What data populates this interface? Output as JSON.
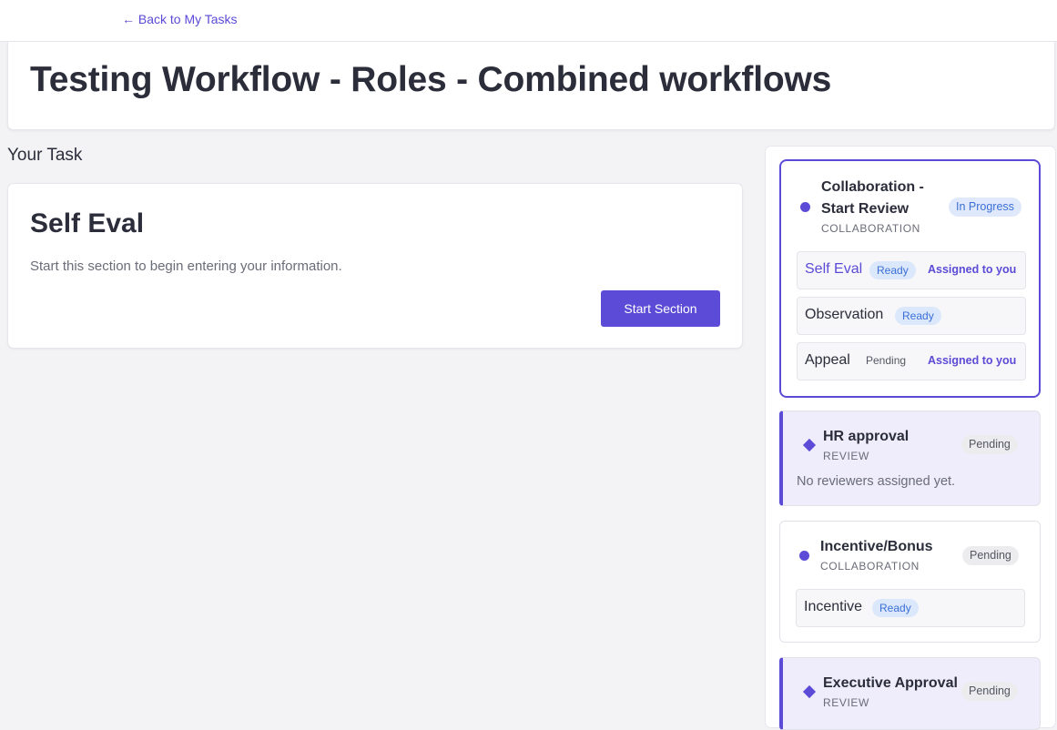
{
  "nav": {
    "back_label": "← Back to My Tasks"
  },
  "page": {
    "title": "Testing Workflow - Roles - Combined workflows"
  },
  "task": {
    "heading": "Your Task",
    "card_title": "Self Eval",
    "description": "Start this section to begin entering your information.",
    "button_label": "Start Section"
  },
  "workflow": {
    "stages": [
      {
        "name_line1": "Collaboration -",
        "name_line2": "Start Review",
        "type": "COLLABORATION",
        "status": "In Progress",
        "sections": [
          {
            "label": "Self Eval",
            "status": "Ready",
            "assigned": "Assigned to you"
          },
          {
            "label": "Observation",
            "status": "Ready",
            "assigned": ""
          },
          {
            "label": "Appeal",
            "status": "Pending",
            "assigned": "Assigned to you"
          }
        ]
      },
      {
        "name": "HR approval",
        "type": "REVIEW",
        "status": "Pending",
        "note": "No reviewers assigned yet."
      },
      {
        "name": "Incentive/Bonus",
        "type": "COLLABORATION",
        "status": "Pending",
        "sections": [
          {
            "label": "Incentive",
            "status": "Ready"
          }
        ]
      },
      {
        "name": "Executive Approval",
        "type": "REVIEW",
        "status": "Pending"
      }
    ]
  },
  "colors": {
    "accent": "#5b4bd6",
    "page_bg": "#f3f3f5",
    "review_bg": "#efedfb",
    "ready_badge_bg": "#dbe7fb",
    "pending_badge_bg": "#ececef"
  }
}
